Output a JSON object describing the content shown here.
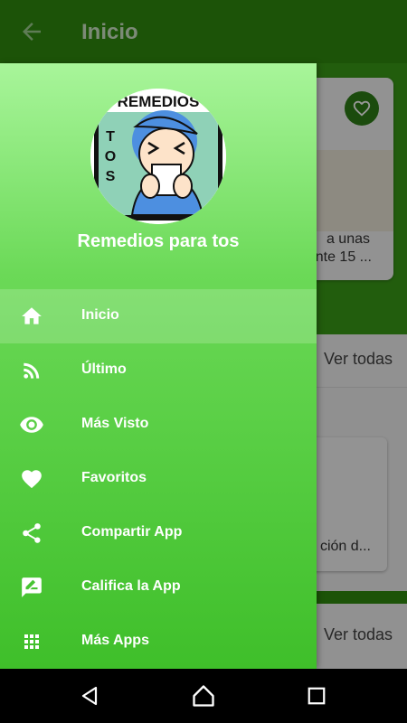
{
  "app_bar": {
    "title": "Inicio"
  },
  "background": {
    "card1_text_line1": "a unas",
    "card1_text_line2": "nte 15 ...",
    "section1_link": "Ver todas",
    "card2_text": "ción d...",
    "section2_link": "Ver todas"
  },
  "drawer": {
    "logo_text_top": "REMEDIOS",
    "logo_text_side": "TOS",
    "app_name": "Remedios para tos",
    "items": [
      {
        "label": "Inicio",
        "icon": "home-icon",
        "active": true
      },
      {
        "label": "Último",
        "icon": "rss-icon"
      },
      {
        "label": "Más Visto",
        "icon": "eye-icon"
      },
      {
        "label": "Favoritos",
        "icon": "heart-icon"
      },
      {
        "label": "Compartir App",
        "icon": "share-icon"
      },
      {
        "label": "Califica la App",
        "icon": "rate-icon"
      },
      {
        "label": "Más Apps",
        "icon": "apps-grid-icon"
      }
    ]
  },
  "colors": {
    "app_bar": "#2f8a0e",
    "drawer_top": "#a8f59a",
    "drawer_bottom": "#3fbf2a"
  }
}
